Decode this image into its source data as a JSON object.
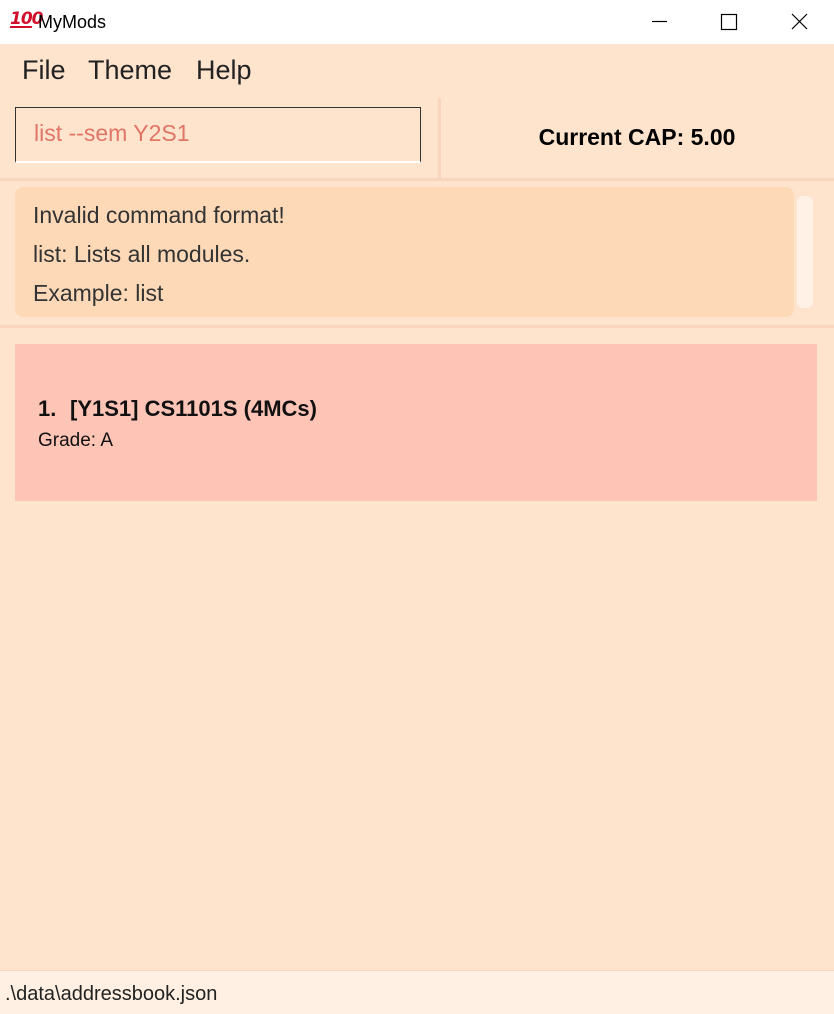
{
  "window": {
    "app_icon_text": "100",
    "title": "MyMods"
  },
  "menu": {
    "file": "File",
    "theme": "Theme",
    "help": "Help"
  },
  "command": {
    "value": "list --sem Y2S1"
  },
  "cap": {
    "label": "Current CAP: 5.00"
  },
  "result": {
    "lines": [
      "Invalid command format!",
      "list: Lists all modules.",
      "Example: list"
    ]
  },
  "modules": [
    {
      "index": "1.",
      "title": "[Y1S1] CS1101S (4MCs)",
      "grade": "Grade: A"
    }
  ],
  "status": {
    "path": ".\\data\\addressbook.json"
  },
  "colors": {
    "background": "#fee4cd",
    "result_box": "#fdd9b8",
    "module_card": "#fec4b6",
    "command_text": "#e07566"
  },
  "icons": {
    "app": "hundred-points-icon",
    "minimize": "minimize-icon",
    "maximize": "maximize-icon",
    "close": "close-icon"
  }
}
